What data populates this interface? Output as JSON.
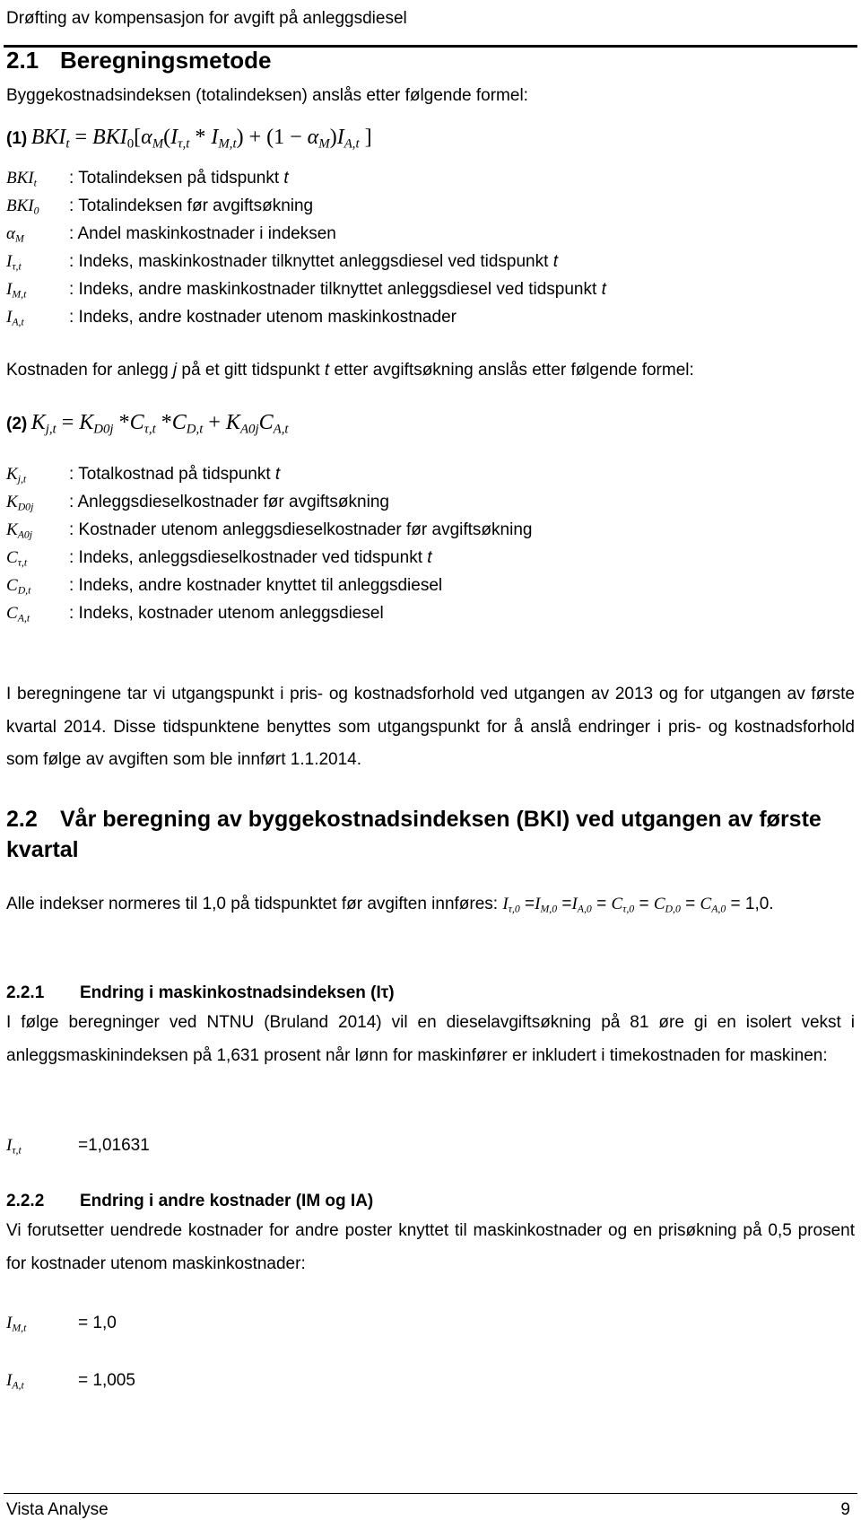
{
  "header": {
    "running_title": "Drøfting av kompensasjon for avgift på anleggsdiesel"
  },
  "s21": {
    "number": "2.1",
    "title": "Beregningsmetode",
    "intro": "Byggekostnadsindeksen (totalindeksen) anslås etter følgende formel:",
    "formula_label": "(1)",
    "formula": "BKIt = BKI0[αM(Iτ,t * IM,t) + (1 − αM)IA,t]",
    "defs": [
      {
        "sym": "BKI",
        "sub": "t",
        "text": ": Totalindeksen på tidspunkt t"
      },
      {
        "sym": "BKI",
        "sub": "0",
        "text": ": Totalindeksen før avgiftsøkning"
      },
      {
        "sym": "α",
        "sub": "M",
        "text": ": Andel maskinkostnader i indeksen"
      },
      {
        "sym": "I",
        "sub": "τ,t",
        "text": ": Indeks, maskinkostnader tilknyttet anleggsdiesel ved tidspunkt t"
      },
      {
        "sym": "I",
        "sub": "M,t",
        "text": ": Indeks, andre maskinkostnader tilknyttet anleggsdiesel ved tidspunkt t"
      },
      {
        "sym": "I",
        "sub": "A,t",
        "text": ": Indeks, andre kostnader utenom maskinkostnader"
      }
    ],
    "intro2": "Kostnaden for anlegg j på et gitt tidspunkt t etter avgiftsøkning anslås etter følgende formel:",
    "formula2_label": "(2)",
    "formula2": "Kj,t = KD0j * Cτ,t * CD,t + KA0jCA,t",
    "defs2": [
      {
        "sym": "K",
        "sub": "j,t",
        "text": ": Totalkostnad på tidspunkt t"
      },
      {
        "sym": "K",
        "sub": "D0j",
        "text": ": Anleggsdieselkostnader før avgiftsøkning"
      },
      {
        "sym": "K",
        "sub": "A0j",
        "text": ": Kostnader utenom anleggsdieselkostnader før avgiftsøkning"
      },
      {
        "sym": "C",
        "sub": "τ,t",
        "text": ": Indeks, anleggsdieselkostnader ved tidspunkt t"
      },
      {
        "sym": "C",
        "sub": "D,t",
        "text": ": Indeks, andre kostnader knyttet til anleggsdiesel"
      },
      {
        "sym": "C",
        "sub": "A,t",
        "text": ": Indeks, kostnader utenom anleggsdiesel"
      }
    ],
    "para": "I beregningene tar vi utgangspunkt i pris- og kostnadsforhold ved utgangen av 2013 og for utgangen av første kvartal 2014. Disse tidspunktene benyttes som utgangspunkt for å anslå endringer i pris- og kostnadsforhold som følge av avgiften som ble innført 1.1.2014."
  },
  "s22": {
    "number": "2.2",
    "title": "Vår beregning av byggekostnadsindeksen (BKI) ved utgangen av første kvartal",
    "para": "Alle indekser normeres til 1,0 på tidspunktet før avgiften innføres: Iτ,0 =IM,0 =IA,0 = Cτ,0 = CD,0 = CA,0 = 1,0."
  },
  "s221": {
    "number": "2.2.1",
    "title": "Endring i maskinkostnadsindeksen (Iτ)",
    "para": "I følge beregninger ved NTNU (Bruland 2014) vil en dieselavgiftsøkning på 81 øre gi en isolert vekst i anleggsmaskinindeksen på 1,631 prosent når lønn for maskinfører er inkludert i timekostnaden for maskinen:",
    "value_sym": "I",
    "value_sub": "τ,t",
    "value": "=1,01631"
  },
  "s222": {
    "number": "2.2.2",
    "title": "Endring i andre kostnader (IM og IA)",
    "para": "Vi forutsetter uendrede kostnader for andre poster knyttet til maskinkostnader og en prisøkning på 0,5 prosent for kostnader utenom maskinkostnader:",
    "v1_sym": "I",
    "v1_sub": "M,t",
    "v1": "= 1,0",
    "v2_sym": "I",
    "v2_sub": "A,t",
    "v2": "= 1,005"
  },
  "footer": {
    "left": "Vista Analyse",
    "page": "9"
  }
}
